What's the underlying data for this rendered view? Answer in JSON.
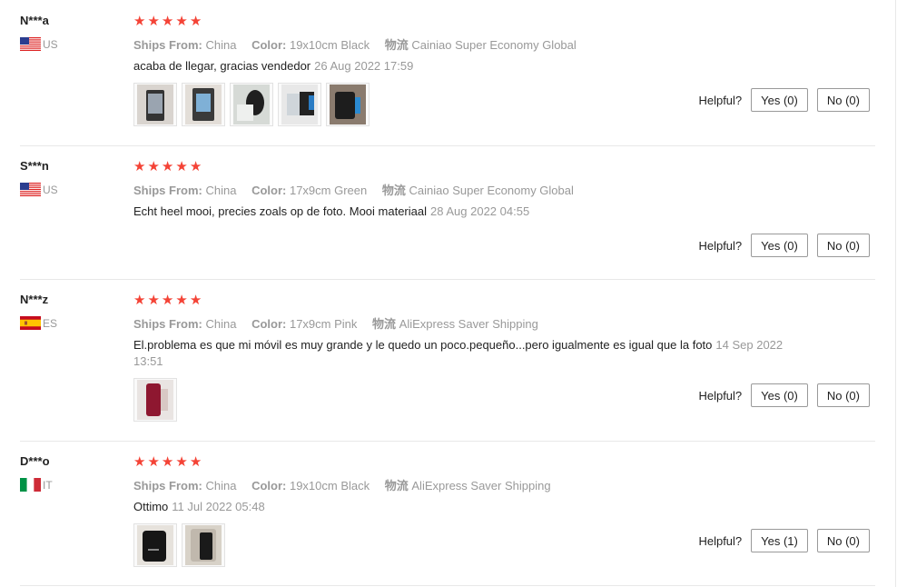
{
  "labels": {
    "ships_from": "Ships From:",
    "color": "Color:",
    "logistics": "物流",
    "helpful": "Helpful?"
  },
  "rating_max": 5,
  "reviews": [
    {
      "user": "N***a",
      "country": "US",
      "rating": 5,
      "ships_from": "China",
      "color": "19x10cm Black",
      "logistics": "Cainiao Super Economy Global",
      "text": "acaba de llegar, gracias vendedor",
      "date": "26 Aug 2022 17:59",
      "yes": "Yes (0)",
      "no": "No (0)"
    },
    {
      "user": "S***n",
      "country": "US",
      "rating": 5,
      "ships_from": "China",
      "color": "17x9cm Green",
      "logistics": "Cainiao Super Economy Global",
      "text": "Echt heel mooi, precies zoals op de foto. Mooi materiaal",
      "date": "28 Aug 2022 04:55",
      "yes": "Yes (0)",
      "no": "No (0)"
    },
    {
      "user": "N***z",
      "country": "ES",
      "rating": 5,
      "ships_from": "China",
      "color": "17x9cm Pink",
      "logistics": "AliExpress Saver Shipping",
      "text": "El.problema es que mi móvil es muy grande y le quedo un poco.pequeño...pero igualmente es igual que la foto",
      "date": "14 Sep 2022 13:51",
      "yes": "Yes (0)",
      "no": "No (0)"
    },
    {
      "user": "D***o",
      "country": "IT",
      "rating": 5,
      "ships_from": "China",
      "color": "19x10cm Black",
      "logistics": "AliExpress Saver Shipping",
      "text": "Ottimo",
      "date": "11 Jul 2022 05:48",
      "yes": "Yes (1)",
      "no": "No (0)"
    }
  ],
  "colors": {
    "star": "#f44336",
    "muted": "#999999",
    "separator": "#e8e8e8"
  }
}
